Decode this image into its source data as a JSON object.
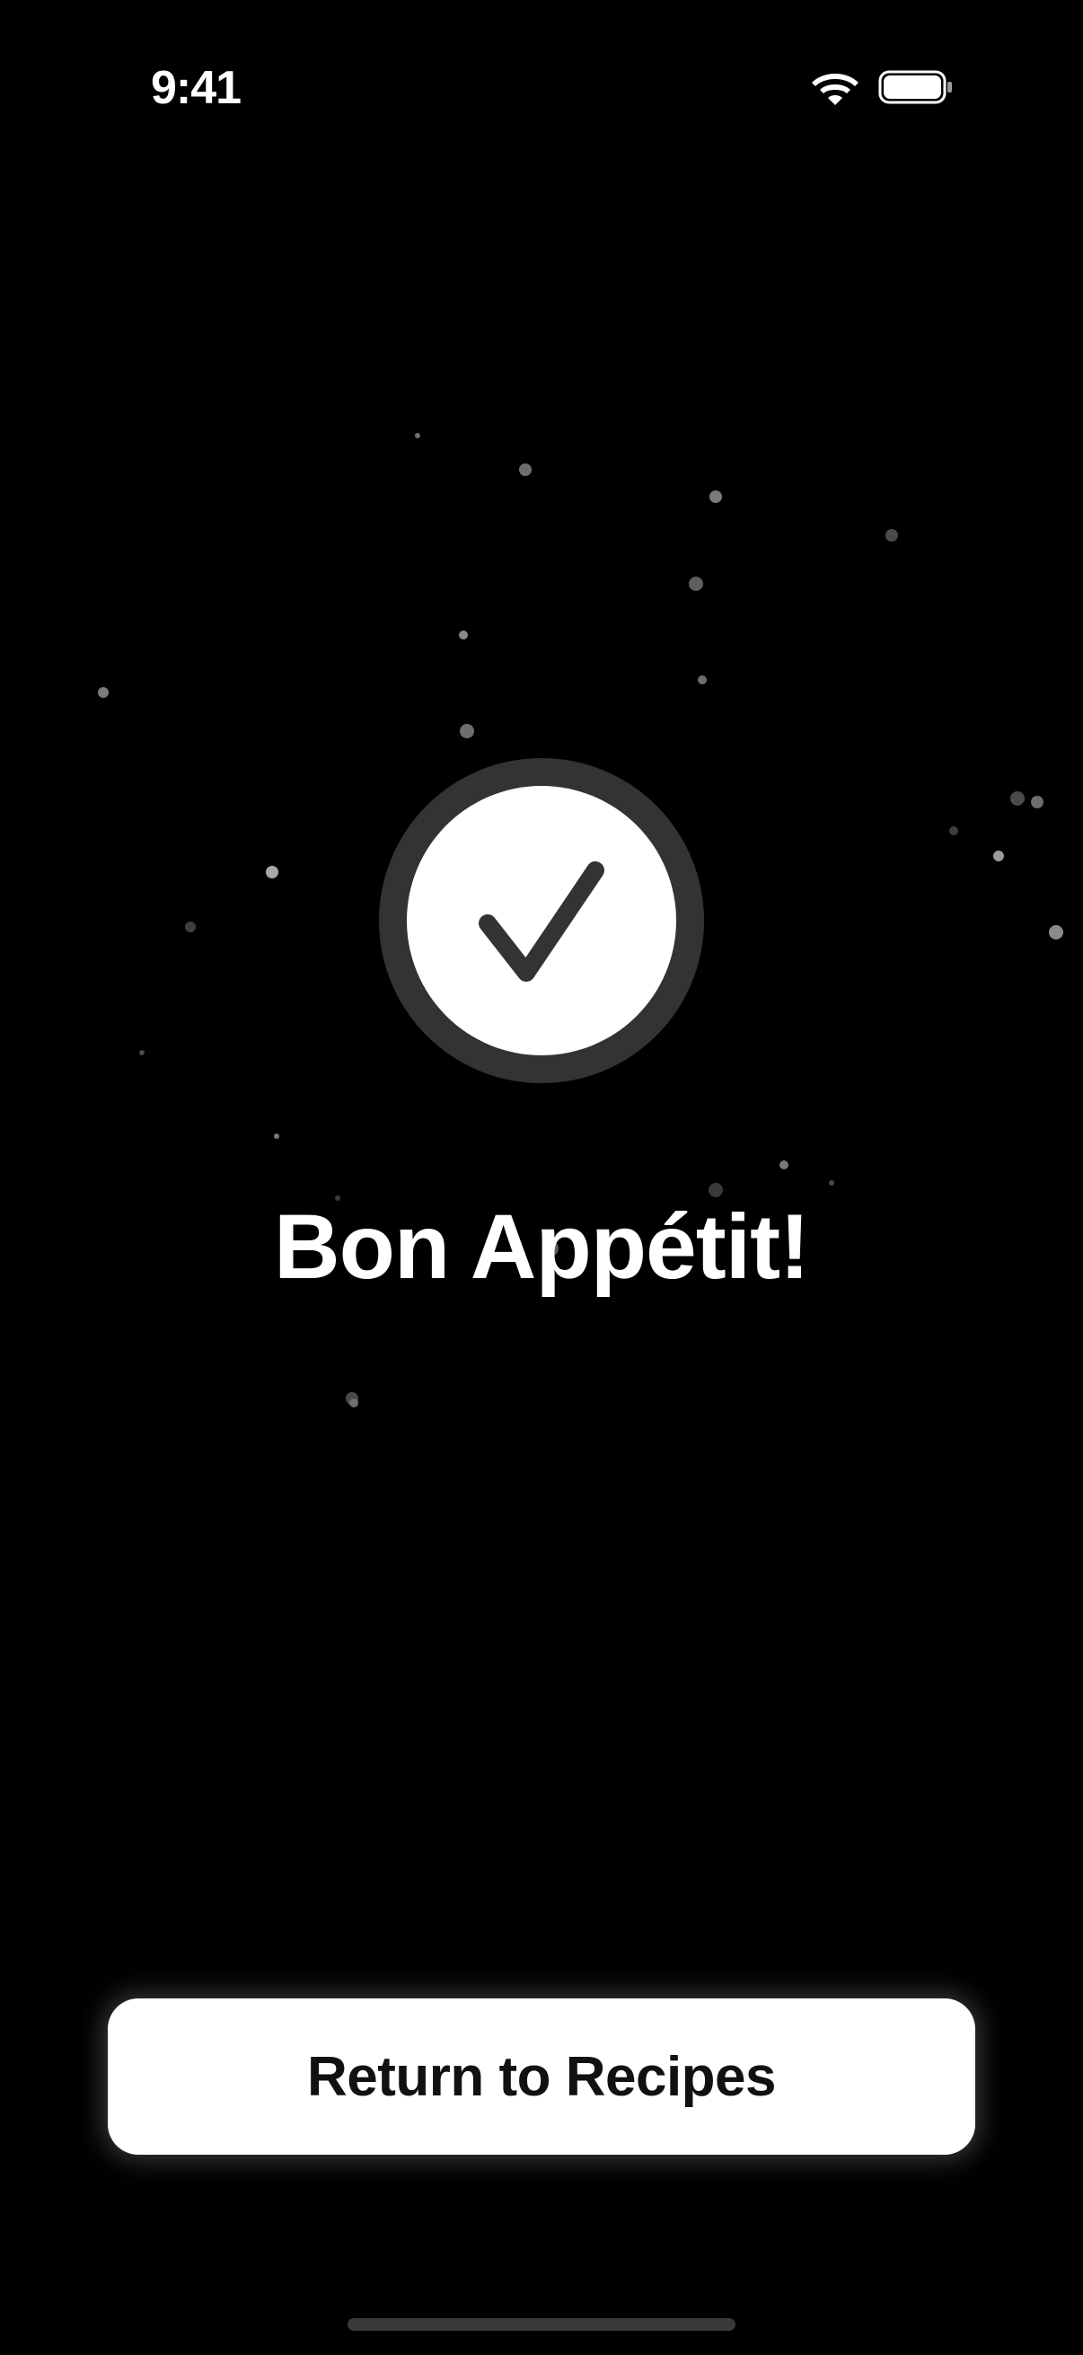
{
  "status_bar": {
    "time": "9:41",
    "wifi_icon": "wifi-icon",
    "battery_icon": "battery-icon"
  },
  "confirmation": {
    "icon": "checkmark-circle-icon",
    "title": "Bon Appétit!"
  },
  "actions": {
    "return_label": "Return to Recipes"
  },
  "colors": {
    "background": "#000000",
    "text": "#ffffff",
    "badge_ring": "#333333",
    "button_background": "#ffffff",
    "button_text": "#111111"
  }
}
